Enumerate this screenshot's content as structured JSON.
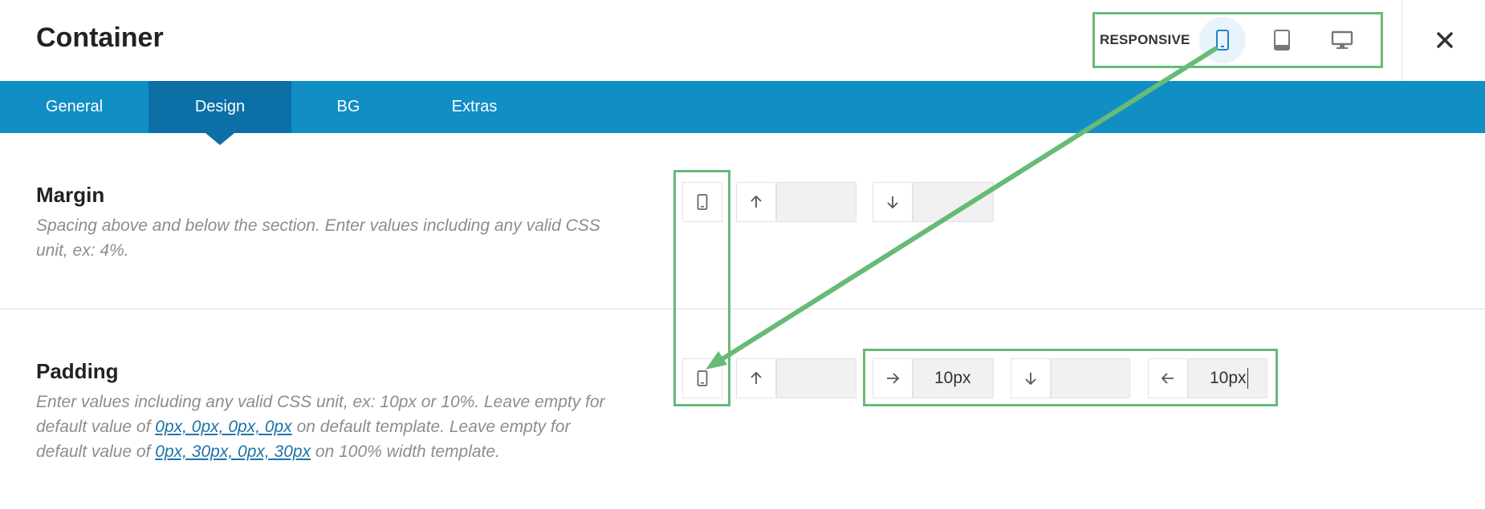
{
  "header": {
    "title": "Container",
    "responsive_label": "RESPONSIVE",
    "devices": [
      {
        "name": "mobile",
        "icon": "phone-icon",
        "active": true
      },
      {
        "name": "tablet",
        "icon": "tablet-icon",
        "active": false
      },
      {
        "name": "desktop",
        "icon": "monitor-icon",
        "active": false
      }
    ],
    "close_icon": "close-icon"
  },
  "tabs": [
    {
      "label": "General",
      "active": false
    },
    {
      "label": "Design",
      "active": true
    },
    {
      "label": "BG",
      "active": false
    },
    {
      "label": "Extras",
      "active": false
    }
  ],
  "margin": {
    "title": "Margin",
    "description": "Spacing above and below the section. Enter values including any valid CSS unit, ex: 4%.",
    "fields": [
      {
        "direction": "top",
        "icon": "arrow-up-icon",
        "value": ""
      },
      {
        "direction": "bottom",
        "icon": "arrow-down-icon",
        "value": ""
      }
    ]
  },
  "padding": {
    "title": "Padding",
    "desc_part1": "Enter values including any valid CSS unit, ex: 10px or 10%. Leave empty for default value of ",
    "link1": "0px, 0px, 0px, 0px",
    "desc_part2": " on default template. Leave empty for default value of ",
    "link2": "0px, 30px, 0px, 30px",
    "desc_part3": " on 100% width template.",
    "fields": [
      {
        "direction": "top",
        "icon": "arrow-up-icon",
        "value": ""
      },
      {
        "direction": "right",
        "icon": "arrow-right-icon",
        "value": "10px"
      },
      {
        "direction": "bottom",
        "icon": "arrow-down-icon",
        "value": ""
      },
      {
        "direction": "left",
        "icon": "arrow-left-icon",
        "value": "10px"
      }
    ]
  },
  "colors": {
    "tabbar": "#118ec4",
    "tab_active": "#0c70a7",
    "highlight": "#66bb77",
    "active_icon": "#1a86c2"
  }
}
